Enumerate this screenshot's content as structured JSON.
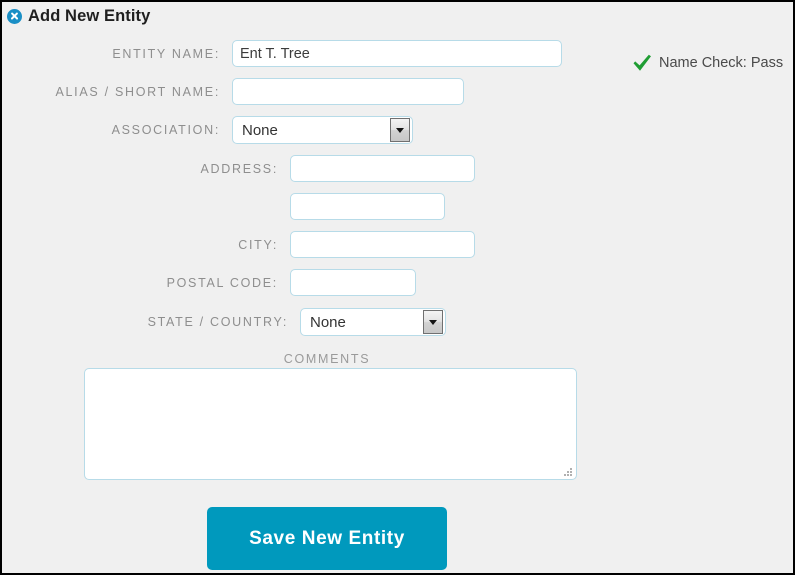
{
  "panel": {
    "title": "Add New Entity",
    "close_icon": "close-circle-icon"
  },
  "name_check": {
    "icon": "green-check-icon",
    "text": "Name Check: Pass"
  },
  "form": {
    "entity_name": {
      "label": "Entity Name:",
      "value": "Ent T. Tree",
      "placeholder": ""
    },
    "alias": {
      "label": "Alias / Short Name:",
      "value": "",
      "placeholder": ""
    },
    "association": {
      "label": "Association:",
      "value": "None",
      "arrow_icon": "chevron-down-icon"
    },
    "address1": {
      "label": "Address:",
      "value": "",
      "placeholder": ""
    },
    "address2": {
      "label": "",
      "value": "",
      "placeholder": ""
    },
    "city": {
      "label": "City:",
      "value": "",
      "placeholder": ""
    },
    "postal_code": {
      "label": "Postal Code:",
      "value": "",
      "placeholder": ""
    },
    "state_country": {
      "label": "State / Country:",
      "value": "None",
      "arrow_icon": "chevron-down-icon"
    },
    "comments": {
      "label": "Comments",
      "value": "",
      "placeholder": ""
    }
  },
  "actions": {
    "save_label": "Save New Entity"
  },
  "colors": {
    "accent": "#0099bd",
    "icon_blue": "#1a8fc6",
    "check_green": "#1f9d33",
    "field_border": "#b7dbe8",
    "label_gray": "#8e8e8e",
    "background": "#f0f0f0"
  }
}
